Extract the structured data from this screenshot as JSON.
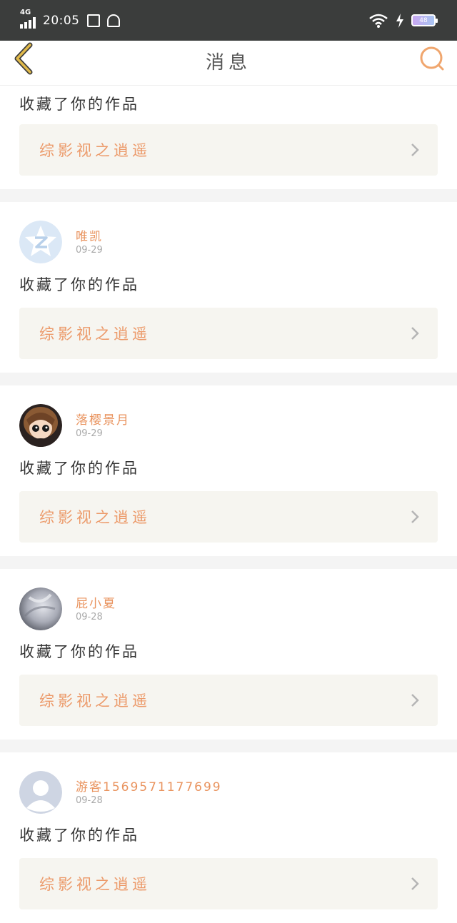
{
  "status_bar": {
    "network": "4G",
    "time": "20:05",
    "battery": "48"
  },
  "header": {
    "title": "消息"
  },
  "notifications": [
    {
      "user": "",
      "date": "",
      "action": "收藏了你的作品",
      "work_title": "综影视之逍遥"
    },
    {
      "user": "唯凯",
      "date": "09-29",
      "action": "收藏了你的作品",
      "work_title": "综影视之逍遥",
      "avatar": "star-logo"
    },
    {
      "user": "落樱景月",
      "date": "09-29",
      "action": "收藏了你的作品",
      "work_title": "综影视之逍遥",
      "avatar": "anime-character"
    },
    {
      "user": "屁小夏",
      "date": "09-28",
      "action": "收藏了你的作品",
      "work_title": "综影视之逍遥",
      "avatar": "gray-photo"
    },
    {
      "user": "游客1569571177699",
      "date": "09-28",
      "action": "收藏了你的作品",
      "work_title": "综影视之逍遥",
      "avatar": "default-person"
    }
  ],
  "colors": {
    "accent": "#e9935e",
    "status_bar": "#3b3d3c",
    "card_bg": "#f6f5f0",
    "back_icon": "#e0b94a"
  }
}
